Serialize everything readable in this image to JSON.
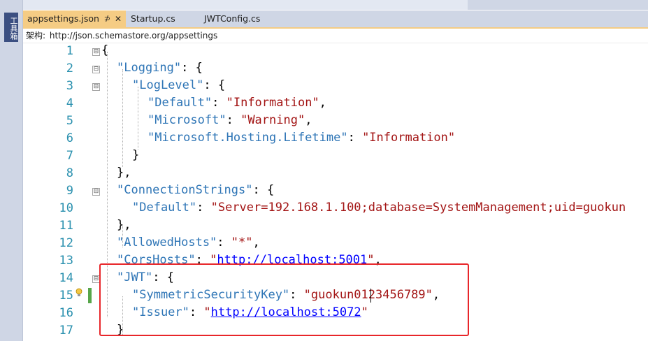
{
  "sidebar": {
    "label": "工具箱"
  },
  "tabs": [
    {
      "label": "appsettings.json",
      "pin": "⊅",
      "close": "✕",
      "active": true
    },
    {
      "label": "Startup.cs",
      "active": false
    },
    {
      "label": "JWTConfig.cs",
      "active": false
    }
  ],
  "schema_bar": {
    "label": "架构:",
    "url": "http://json.schemastore.org/appsettings"
  },
  "editor": {
    "lines": [
      {
        "num": "1",
        "tokens": [
          {
            "t": "p",
            "v": "{"
          }
        ]
      },
      {
        "num": "2",
        "tokens": [
          {
            "t": "k",
            "v": "\"Logging\""
          },
          {
            "t": "p",
            "v": ": {"
          }
        ]
      },
      {
        "num": "3",
        "tokens": [
          {
            "t": "k",
            "v": "\"LogLevel\""
          },
          {
            "t": "p",
            "v": ": {"
          }
        ]
      },
      {
        "num": "4",
        "tokens": [
          {
            "t": "k",
            "v": "\"Default\""
          },
          {
            "t": "p",
            "v": ": "
          },
          {
            "t": "s",
            "v": "\"Information\""
          },
          {
            "t": "p",
            "v": ","
          }
        ]
      },
      {
        "num": "5",
        "tokens": [
          {
            "t": "k",
            "v": "\"Microsoft\""
          },
          {
            "t": "p",
            "v": ": "
          },
          {
            "t": "s",
            "v": "\"Warning\""
          },
          {
            "t": "p",
            "v": ","
          }
        ]
      },
      {
        "num": "6",
        "tokens": [
          {
            "t": "k",
            "v": "\"Microsoft.Hosting.Lifetime\""
          },
          {
            "t": "p",
            "v": ": "
          },
          {
            "t": "s",
            "v": "\"Information\""
          }
        ]
      },
      {
        "num": "7",
        "tokens": [
          {
            "t": "p",
            "v": "}"
          }
        ]
      },
      {
        "num": "8",
        "tokens": [
          {
            "t": "p",
            "v": "},"
          }
        ]
      },
      {
        "num": "9",
        "tokens": [
          {
            "t": "k",
            "v": "\"ConnectionStrings\""
          },
          {
            "t": "p",
            "v": ": {"
          }
        ]
      },
      {
        "num": "10",
        "tokens": [
          {
            "t": "k",
            "v": "\"Default\""
          },
          {
            "t": "p",
            "v": ": "
          },
          {
            "t": "s",
            "v": "\"Server=192.168.1.100;database=SystemManagement;uid=guokun"
          }
        ]
      },
      {
        "num": "11",
        "tokens": [
          {
            "t": "p",
            "v": "},"
          }
        ]
      },
      {
        "num": "12",
        "tokens": [
          {
            "t": "k",
            "v": "\"AllowedHosts\""
          },
          {
            "t": "p",
            "v": ": "
          },
          {
            "t": "s",
            "v": "\"*\""
          },
          {
            "t": "p",
            "v": ","
          }
        ]
      },
      {
        "num": "13",
        "tokens": [
          {
            "t": "k",
            "v": "\"CorsHosts\""
          },
          {
            "t": "p",
            "v": ": "
          },
          {
            "t": "s",
            "v": "\""
          },
          {
            "t": "u",
            "v": "http://localhost:5001"
          },
          {
            "t": "s",
            "v": "\""
          },
          {
            "t": "p",
            "v": ","
          }
        ]
      },
      {
        "num": "14",
        "tokens": [
          {
            "t": "k",
            "v": "\"JWT\""
          },
          {
            "t": "p",
            "v": ": {"
          }
        ]
      },
      {
        "num": "15",
        "tokens": [
          {
            "t": "k",
            "v": "\"SymmetricSecurityKey\""
          },
          {
            "t": "p",
            "v": ": "
          },
          {
            "t": "s",
            "v": "\"guokun0123456789\""
          },
          {
            "t": "p",
            "v": ","
          }
        ]
      },
      {
        "num": "16",
        "tokens": [
          {
            "t": "k",
            "v": "\"Issuer\""
          },
          {
            "t": "p",
            "v": ": "
          },
          {
            "t": "s",
            "v": "\""
          },
          {
            "t": "u",
            "v": "http://localhost:5072"
          },
          {
            "t": "s",
            "v": "\""
          }
        ]
      },
      {
        "num": "17",
        "tokens": [
          {
            "t": "p",
            "v": "}"
          }
        ]
      }
    ],
    "fold_markers": [
      "⊟"
    ]
  },
  "colors": {
    "keyword_blue": "#2e75b6",
    "string_red": "#a31515",
    "line_number": "#2b91af",
    "highlight_box": "#e8262a",
    "active_tab": "#f5cc84"
  }
}
